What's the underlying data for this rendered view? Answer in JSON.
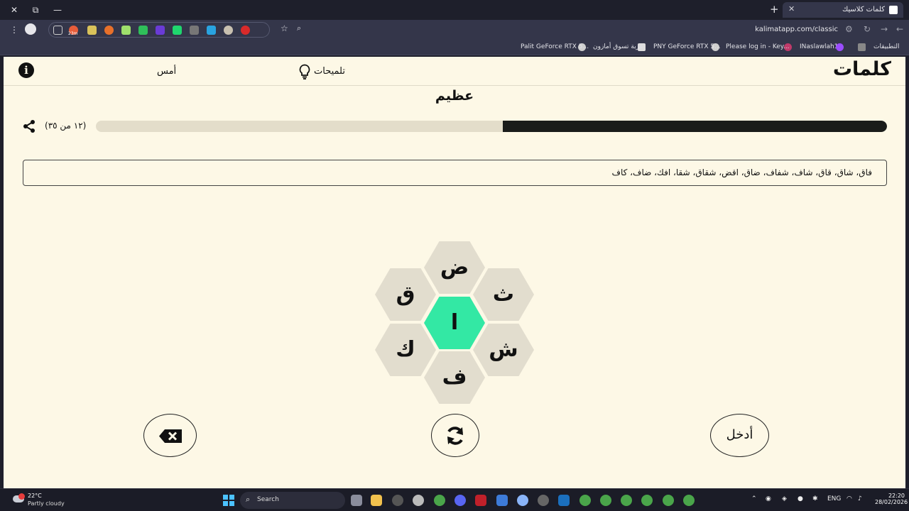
{
  "browser": {
    "tab_title": "كلمات كلاسيك",
    "url": "kalimatapp.com/classic",
    "bookmarks": [
      {
        "label": "التطبيقات"
      },
      {
        "label": "INaslawlah18"
      },
      {
        "label": "Please log in - Key..."
      },
      {
        "label": "PNY GeForce RTX 5..."
      },
      {
        "label": "عربة تسوق أمازون"
      },
      {
        "label": "Palit GeForce RTX 5..."
      }
    ],
    "extension_badge": "23m"
  },
  "header": {
    "brand": "كلمات",
    "hints_label": "تلميحات",
    "yesterday_label": "أمس",
    "info_glyph": "i"
  },
  "game": {
    "rank": "عظيم",
    "count_text": "(١٢ من ٣٥)",
    "progress_fraction": 0.4857,
    "found_words": "فاق، شاق، قاق، شاف، شفاف، ضاق، اقض، شقاق، شقا، افك، ضاف، كاف",
    "letters": {
      "center": "ا",
      "top": "ض",
      "top_left": "ق",
      "top_right": "ث",
      "bottom_left": "ك",
      "bottom_right": "ش",
      "bottom": "ف"
    },
    "enter_label": "أدخل"
  },
  "taskbar": {
    "weather_temp": "22°C",
    "weather_desc": "Partly cloudy",
    "search_label": "Search",
    "lang": "ENG",
    "time": "22:20",
    "date": "28/02/2026"
  },
  "colors": {
    "page_bg": "#fdf8e6",
    "center_hex": "#33e8a4",
    "outer_hex": "#e2ddce",
    "progress_fill": "#1a1c1a",
    "progress_track": "#e3ddca"
  }
}
